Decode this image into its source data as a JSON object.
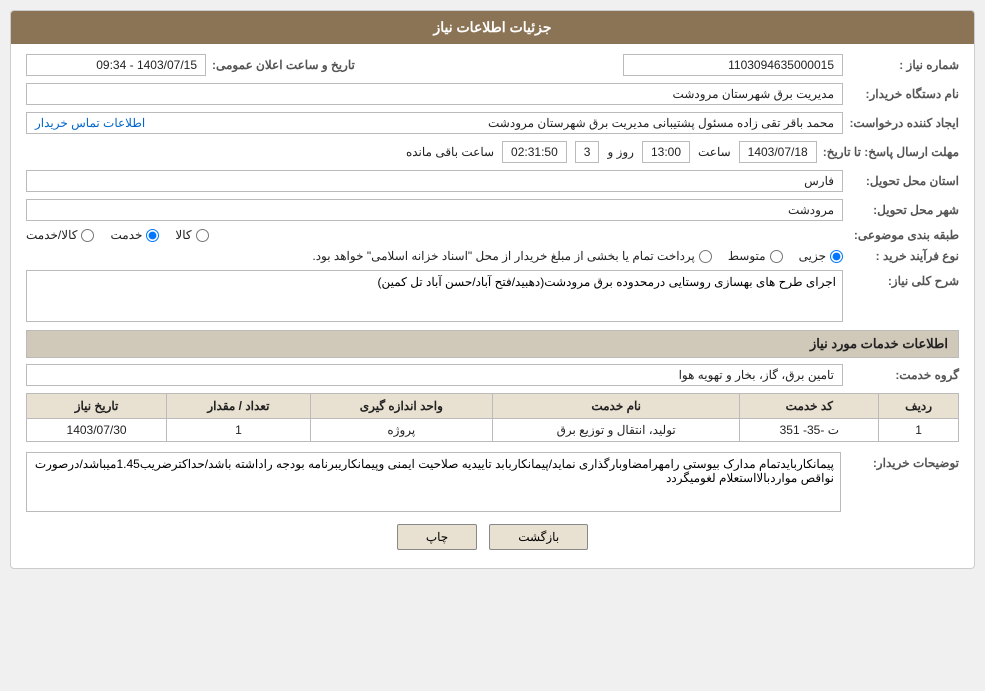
{
  "header": {
    "title": "جزئیات اطلاعات نیاز"
  },
  "fields": {
    "need_number_label": "شماره نیاز :",
    "need_number_value": "1103094635000015",
    "buyer_name_label": "نام دستگاه خریدار:",
    "buyer_name_value": "مدیریت برق شهرستان مرودشت",
    "creator_label": "ایجاد کننده درخواست:",
    "creator_value": "محمد باقر  تقی زاده مسئول پشتیبانی مدیریت برق شهرستان مرودشت",
    "creator_link": "اطلاعات تماس خریدار",
    "deadline_label": "مهلت ارسال پاسخ: تا تاریخ:",
    "deadline_date": "1403/07/18",
    "deadline_time_label": "ساعت",
    "deadline_time": "13:00",
    "deadline_days_label": "روز و",
    "deadline_days": "3",
    "deadline_remaining_label": "ساعت باقی مانده",
    "deadline_remaining": "02:31:50",
    "announce_label": "تاریخ و ساعت اعلان عمومی:",
    "announce_value": "1403/07/15 - 09:34",
    "province_label": "استان محل تحویل:",
    "province_value": "فارس",
    "city_label": "شهر محل تحویل:",
    "city_value": "مرودشت",
    "category_label": "طبقه بندی موضوعی:",
    "category_options": [
      {
        "label": "کالا",
        "value": "kala"
      },
      {
        "label": "خدمت",
        "value": "khadamat"
      },
      {
        "label": "کالا/خدمت",
        "value": "kala_khadamat"
      }
    ],
    "category_selected": "khadamat",
    "process_label": "نوع فرآیند خرید :",
    "process_options": [
      {
        "label": "جزیی",
        "value": "jozi"
      },
      {
        "label": "متوسط",
        "value": "motavaset"
      },
      {
        "label": "پرداخت تمام یا بخشی از مبلغ خریدار از محل \"اسناد خزانه اسلامی\" خواهد بود.",
        "value": "esnad"
      }
    ],
    "process_selected": "jozi",
    "description_label": "شرح کلی نیاز:",
    "description_value": "اجرای طرح های بهسازی روستایی درمحدوده برق مرودشت(دهبید/فتح آباد/حسن آباد تل کمین)",
    "services_section_label": "اطلاعات خدمات مورد نیاز",
    "service_group_label": "گروه خدمت:",
    "service_group_value": "تامین برق، گاز، بخار و تهویه هوا"
  },
  "table": {
    "headers": [
      "ردیف",
      "کد خدمت",
      "نام خدمت",
      "واحد اندازه گیری",
      "تعداد / مقدار",
      "تاریخ نیاز"
    ],
    "rows": [
      {
        "row": "1",
        "code": "ت -35- 351",
        "name": "تولید، انتقال و توزیع برق",
        "unit": "پروژه",
        "qty": "1",
        "date": "1403/07/30"
      }
    ]
  },
  "buyer_notes_label": "توضیحات خریدار:",
  "buyer_notes_value": "پیمانکاربایدتمام مدارک بیوستی رامهرامضاوبارگذاری نماید/پیمانکاربابد تاییدیه صلاحیت ایمنی وپیمانکاریبرنامه بودجه راداشته باشد/حداکترضریب1.45میباشد/درصورت نواقص مواردبالااستعلام لغومیگردد",
  "buttons": {
    "print": "چاپ",
    "back": "بازگشت"
  }
}
